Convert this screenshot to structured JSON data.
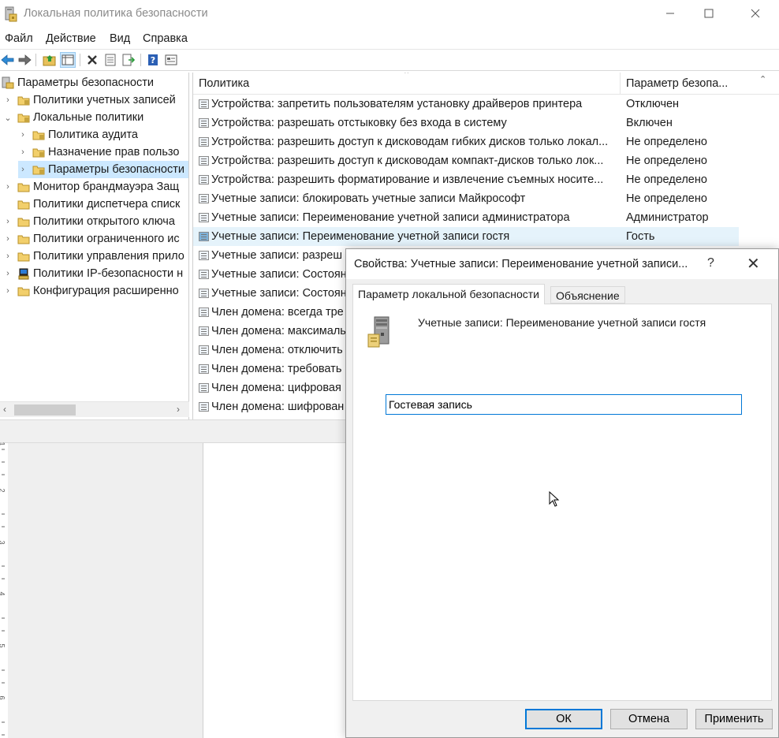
{
  "window": {
    "title": "Локальная политика безопасности",
    "icon": "security-policy-icon"
  },
  "menu": [
    "Файл",
    "Действие",
    "Вид",
    "Справка"
  ],
  "toolbar": {
    "icons": [
      "back-arrow-icon",
      "forward-arrow-icon",
      "up-folder-icon",
      "show-hide-tree-icon",
      "delete-icon",
      "properties-icon",
      "export-list-icon",
      "help-icon",
      "console-view-icon"
    ]
  },
  "tree": {
    "items": [
      {
        "label": "Параметры безопасности",
        "level": 0,
        "expanded": true
      },
      {
        "label": "Политики учетных записей",
        "level": 1,
        "expanded": false
      },
      {
        "label": "Локальные политики",
        "level": 1,
        "expanded": true
      },
      {
        "label": "Политика аудита",
        "level": 2,
        "expanded": false
      },
      {
        "label": "Назначение прав пользо",
        "level": 2,
        "expanded": false
      },
      {
        "label": "Параметры безопасности",
        "level": 2,
        "expanded": false,
        "selected": true
      },
      {
        "label": "Монитор брандмауэра Защ",
        "level": 1,
        "expanded": false
      },
      {
        "label": "Политики диспетчера списк",
        "level": 1,
        "expanded": false
      },
      {
        "label": "Политики открытого ключа",
        "level": 1,
        "expanded": false
      },
      {
        "label": "Политики ограниченного ис",
        "level": 1,
        "expanded": false
      },
      {
        "label": "Политики управления прило",
        "level": 1,
        "expanded": false
      },
      {
        "label": "Политики IP-безопасности н",
        "level": 1,
        "expanded": false
      },
      {
        "label": "Конфигурация расширенно",
        "level": 1,
        "expanded": false
      }
    ]
  },
  "list": {
    "columns": {
      "policy": "Политика",
      "param": "Параметр безопа..."
    },
    "rows": [
      {
        "policy": "Устройства: запретить пользователям установку драйверов принтера",
        "value": "Отключен"
      },
      {
        "policy": "Устройства: разрешать отстыковку без входа в систему",
        "value": "Включен"
      },
      {
        "policy": "Устройства: разрешить доступ к дисководам гибких дисков только локал...",
        "value": "Не определено"
      },
      {
        "policy": "Устройства: разрешить доступ к дисководам компакт-дисков только лок...",
        "value": "Не определено"
      },
      {
        "policy": "Устройства: разрешить форматирование и извлечение съемных носите...",
        "value": "Не определено"
      },
      {
        "policy": "Учетные записи: блокировать учетные записи Майкрософт",
        "value": "Не определено"
      },
      {
        "policy": "Учетные записи: Переименование учетной записи администратора",
        "value": "Администратор"
      },
      {
        "policy": "Учетные записи: Переименование учетной записи гостя",
        "value": "Гость",
        "selected": true
      },
      {
        "policy": "Учетные записи: разреш",
        "value": ""
      },
      {
        "policy": "Учетные записи: Состоян",
        "value": ""
      },
      {
        "policy": "Учетные записи: Состоян",
        "value": ""
      },
      {
        "policy": "Член домена: всегда тре",
        "value": ""
      },
      {
        "policy": "Член домена: максималь",
        "value": ""
      },
      {
        "policy": "Член домена: отключить",
        "value": ""
      },
      {
        "policy": "Член домена: требовать",
        "value": ""
      },
      {
        "policy": "Член домена: цифровая",
        "value": ""
      },
      {
        "policy": "Член домена: шифрован",
        "value": ""
      }
    ]
  },
  "ruler": {
    "marks": [
      "1",
      "2",
      "3",
      "4",
      "5",
      "6"
    ]
  },
  "dialog": {
    "title": "Свойства: Учетные записи: Переименование учетной записи...",
    "help": "?",
    "close": "✕",
    "tabs": [
      "Параметр локальной безопасности",
      "Объяснение"
    ],
    "policy_name": "Учетные записи: Переименование учетной записи гостя",
    "input_value": "Гостевая запись",
    "buttons": {
      "ok": "ОК",
      "cancel": "Отмена",
      "apply": "Применить"
    }
  }
}
